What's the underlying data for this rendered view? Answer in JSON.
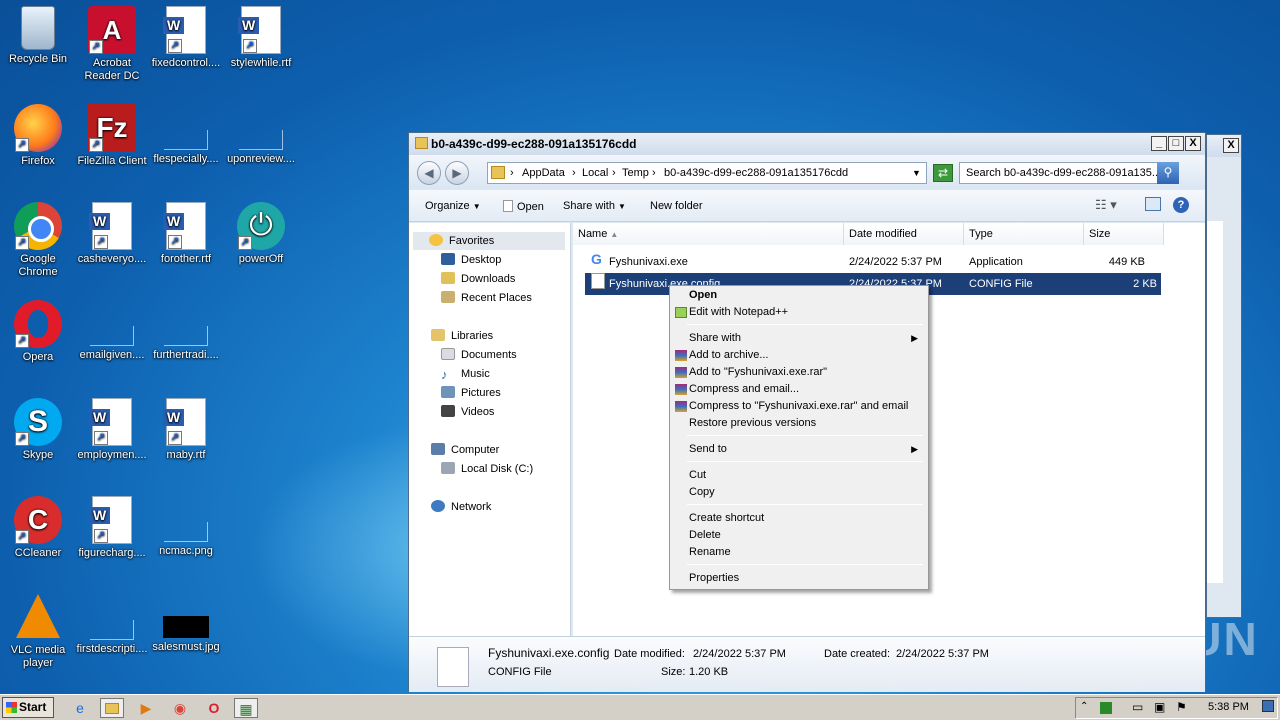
{
  "desktop": {
    "icons": [
      {
        "label": "Recycle Bin"
      },
      {
        "label": "Acrobat Reader DC"
      },
      {
        "label": "fixedcontrol...."
      },
      {
        "label": "stylewhile.rtf"
      },
      {
        "label": "Firefox"
      },
      {
        "label": "FileZilla Client"
      },
      {
        "label": "flespecially...."
      },
      {
        "label": "uponreview...."
      },
      {
        "label": "Google Chrome"
      },
      {
        "label": "casheveryo...."
      },
      {
        "label": "forother.rtf"
      },
      {
        "label": "powerOff"
      },
      {
        "label": "Opera"
      },
      {
        "label": "emailgiven...."
      },
      {
        "label": "furthertradi...."
      },
      {
        "label": "Skype"
      },
      {
        "label": "employmen...."
      },
      {
        "label": "maby.rtf"
      },
      {
        "label": "CCleaner"
      },
      {
        "label": "figurecharg...."
      },
      {
        "label": "ncmac.png"
      },
      {
        "label": "VLC media player"
      },
      {
        "label": "firstdescripti...."
      },
      {
        "label": "salesmust.jpg"
      }
    ],
    "watermark": "ANY RUN"
  },
  "explorer": {
    "title": "b0-a439c-d99-ec288-091a135176cdd",
    "window_buttons": {
      "minimize": "_",
      "maximize": "□",
      "close": "X"
    },
    "address": {
      "crumbs": [
        "AppData",
        "Local",
        "Temp",
        "b0-a439c-d99-ec288-091a135176cdd"
      ],
      "separator": "›"
    },
    "search_placeholder": "Search b0-a439c-d99-ec288-091a135...",
    "toolbar": {
      "organize": "Organize",
      "open": "Open",
      "share_with": "Share with",
      "new_folder": "New folder"
    },
    "nav": {
      "favorites": "Favorites",
      "desktop": "Desktop",
      "downloads": "Downloads",
      "recent_places": "Recent Places",
      "libraries": "Libraries",
      "documents": "Documents",
      "music": "Music",
      "pictures": "Pictures",
      "videos": "Videos",
      "computer": "Computer",
      "local_disk": "Local Disk (C:)",
      "network": "Network"
    },
    "columns": {
      "name": "Name",
      "date": "Date modified",
      "type": "Type",
      "size": "Size"
    },
    "files": [
      {
        "name": "Fyshunivaxi.exe",
        "date": "2/24/2022 5:37 PM",
        "type": "Application",
        "size": "449 KB"
      },
      {
        "name": "Fyshunivaxi.exe.config",
        "date": "2/24/2022 5:37 PM",
        "type": "CONFIG File",
        "size": "2 KB"
      }
    ],
    "details": {
      "filename": "Fyshunivaxi.exe.config",
      "filetype": "CONFIG File",
      "date_modified_label": "Date modified:",
      "date_modified": "2/24/2022 5:37 PM",
      "size_label": "Size:",
      "size": "1.20 KB",
      "date_created_label": "Date created:",
      "date_created": "2/24/2022 5:37 PM"
    }
  },
  "context_menu": {
    "open": "Open",
    "edit_notepad": "Edit with Notepad++",
    "share_with": "Share with",
    "add_archive": "Add to archive...",
    "add_rar": "Add to \"Fyshunivaxi.exe.rar\"",
    "compress_email": "Compress and email...",
    "compress_rar_email": "Compress to \"Fyshunivaxi.exe.rar\" and email",
    "restore": "Restore previous versions",
    "send_to": "Send to",
    "cut": "Cut",
    "copy": "Copy",
    "create_shortcut": "Create shortcut",
    "delete": "Delete",
    "rename": "Rename",
    "properties": "Properties"
  },
  "taskbar": {
    "start": "Start",
    "clock": "5:38 PM"
  }
}
